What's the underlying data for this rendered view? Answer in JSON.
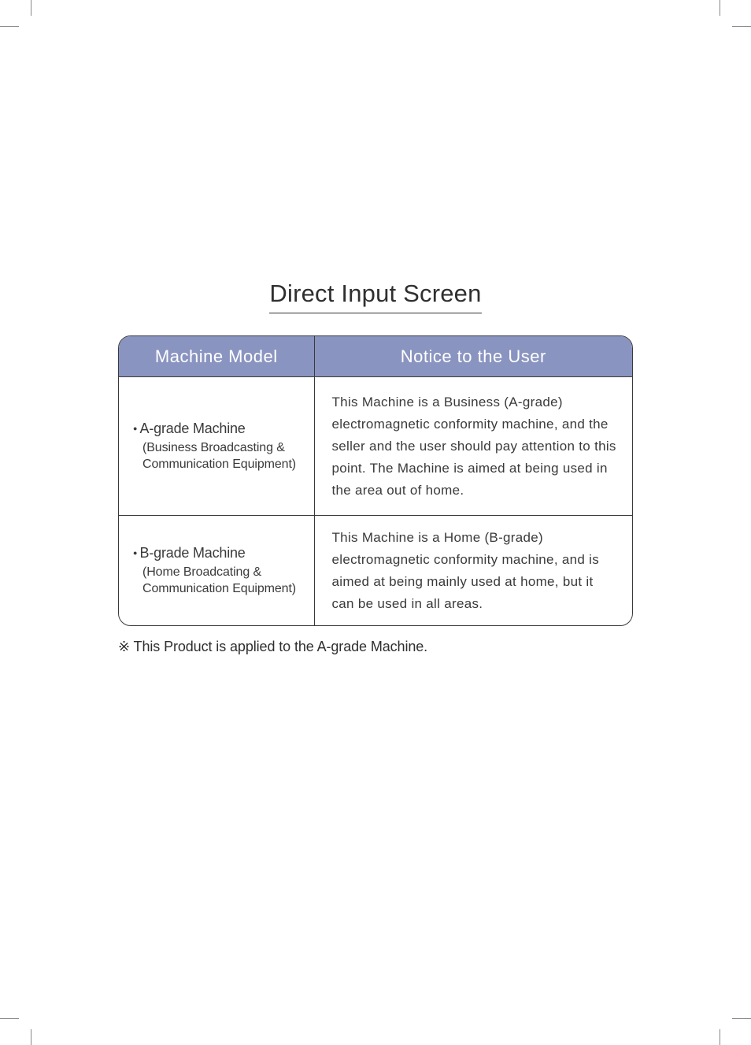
{
  "title": "Direct Input Screen",
  "headers": {
    "model": "Machine Model",
    "notice": "Notice to the User"
  },
  "rows": [
    {
      "model_title": "A-grade Machine",
      "model_sub": "(Business Broadcasting & Communication Equipment)",
      "notice": "This Machine is a Business (A-grade) electromagnetic conformity machine, and the seller and the\nuser should pay attention to this point. The Machine is aimed at being used in the area out of home."
    },
    {
      "model_title": "B-grade Machine",
      "model_sub": "(Home Broadcating & Communication Equipment)",
      "notice": "This Machine is a Home (B-grade) electromagnetic conformity machine, and is aimed at being mainly used at home, but it can be used in all areas."
    }
  ],
  "footnote": "※ This Product is applied to the A-grade Machine."
}
